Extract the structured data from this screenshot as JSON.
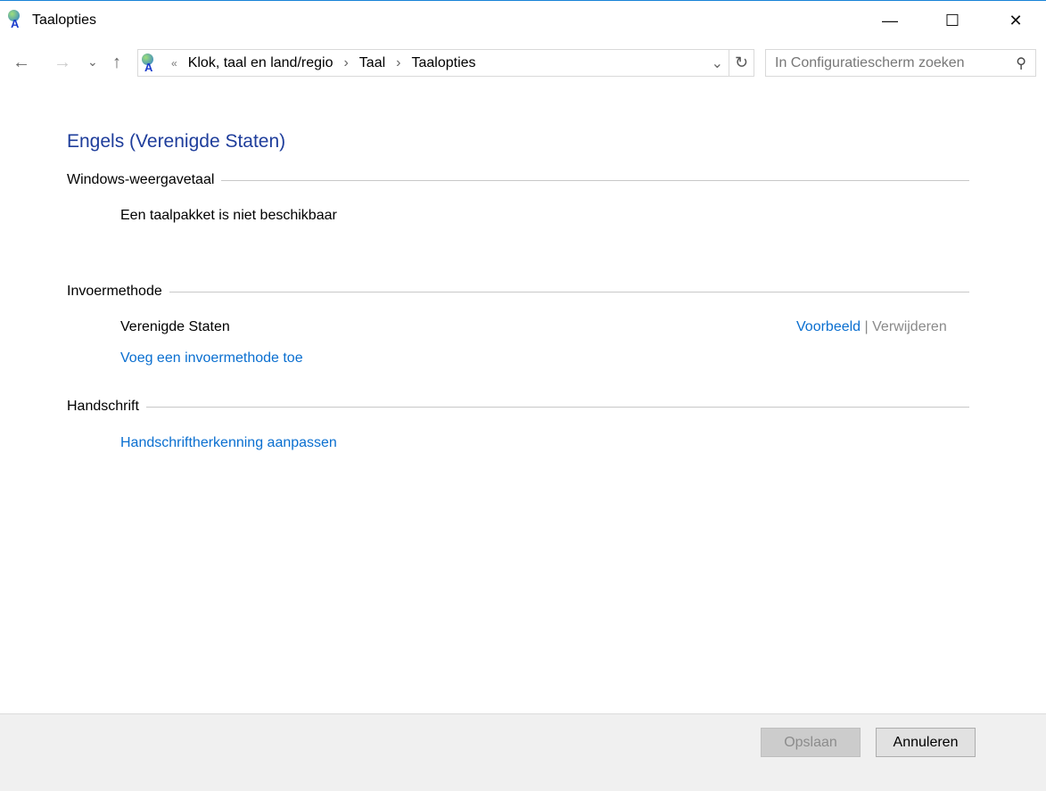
{
  "window": {
    "title": "Taalopties",
    "minimize": "—",
    "maximize": "☐",
    "close": "✕"
  },
  "nav": {
    "back": "←",
    "forward": "→",
    "recent": "⌄",
    "up": "↑",
    "refresh": "↻"
  },
  "address": {
    "overflow": "«",
    "crumbs": [
      "Klok, taal en land/regio",
      "Taal",
      "Taalopties"
    ],
    "separator": "›",
    "dropdown": "⌄"
  },
  "search": {
    "placeholder": "In Configuratiescherm zoeken"
  },
  "main": {
    "language": "Engels (Verenigde Staten)",
    "display_section": "Windows-weergavetaal",
    "display_status": "Een taalpakket is niet beschikbaar",
    "input_section": "Invoermethode",
    "input_method": "Verenigde Staten",
    "preview": "Voorbeeld",
    "pipe": "|",
    "remove": "Verwijderen",
    "add_input": "Voeg een invoermethode toe",
    "handwriting_section": "Handschrift",
    "handwriting_link": "Handschriftherkenning aanpassen"
  },
  "footer": {
    "save": "Opslaan",
    "cancel": "Annuleren"
  }
}
